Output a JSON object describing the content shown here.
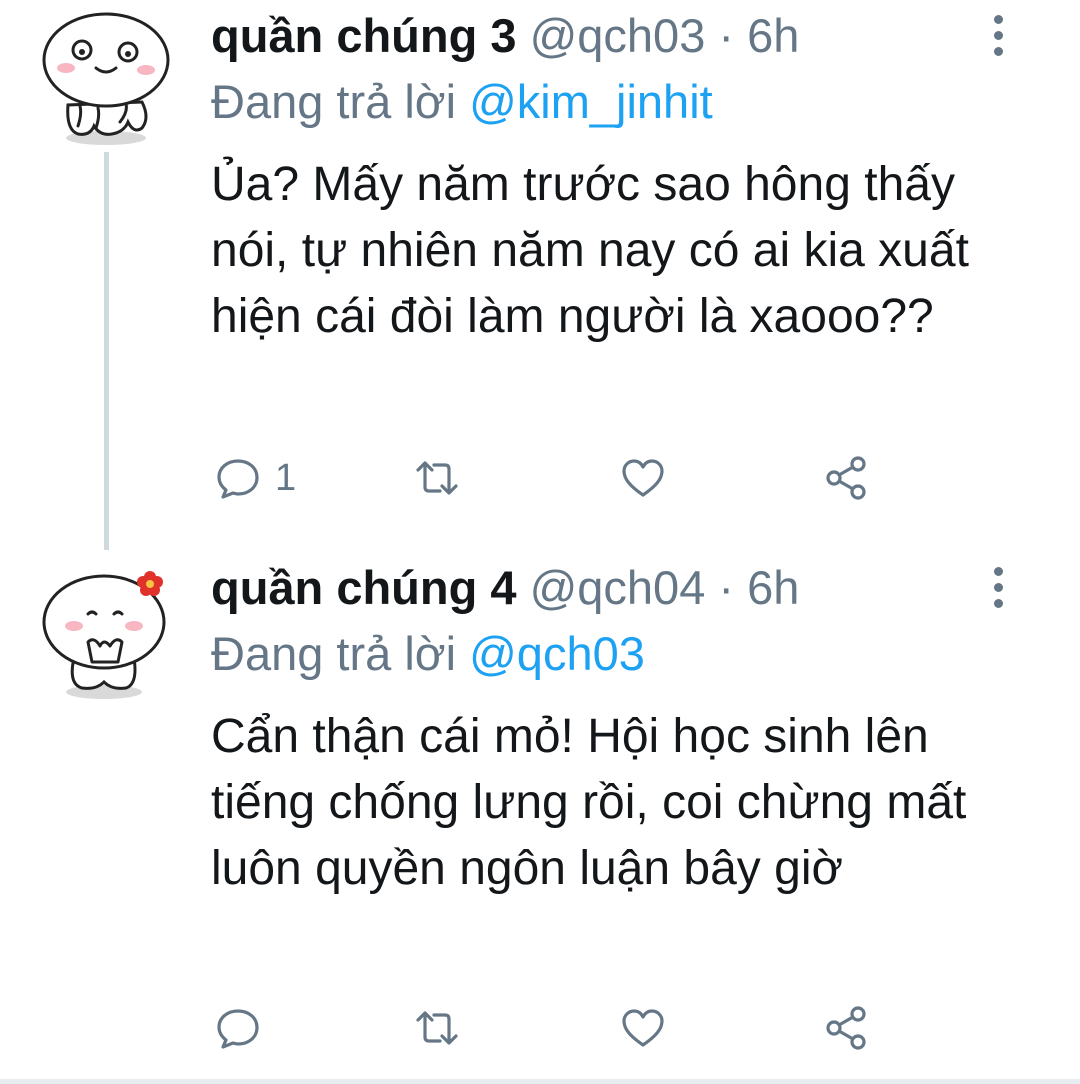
{
  "tweets": [
    {
      "display_name": "quần chúng 3",
      "handle": "@qch03",
      "separator": "·",
      "time": "6h",
      "reply_prefix": "Đang trả lời",
      "reply_mention": "@kim_jinhit",
      "text": "Ủa? Mấy năm trước sao hông thấy nói, tự nhiên năm nay có ai kia xuất hiện cái đòi làm người là xaooo??",
      "reply_count": "1",
      "avatar_icon": "bun-character-avatar-icon"
    },
    {
      "display_name": "quần chúng 4",
      "handle": "@qch04",
      "separator": "·",
      "time": "6h",
      "reply_prefix": "Đang trả lời",
      "reply_mention": "@qch03",
      "text": "Cẩn thận cái mỏ! Hội học sinh lên tiếng chống lưng rồi, coi chừng mất luôn quyền ngôn luận bây giờ",
      "reply_count": "",
      "avatar_icon": "bun-character-flower-avatar-icon"
    }
  ],
  "colors": {
    "text_primary": "#14171a",
    "text_secondary": "#657786",
    "link": "#1da1f2",
    "thread_line": "#cfd9de",
    "flower": "#e0312b"
  },
  "icons": [
    "reply-icon",
    "retweet-icon",
    "like-icon",
    "share-icon",
    "more-options-icon"
  ]
}
